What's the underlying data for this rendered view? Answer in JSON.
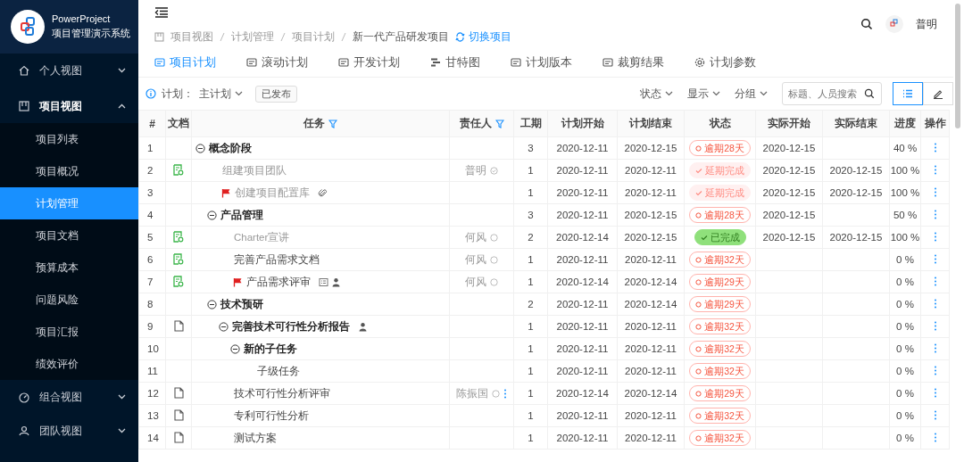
{
  "brand": {
    "name": "PowerProject",
    "subtitle": "项目管理演示系统"
  },
  "sidebar": {
    "groups": [
      {
        "label": "个人视图",
        "expanded": false,
        "selected": false
      },
      {
        "label": "项目视图",
        "expanded": true,
        "selected": true,
        "children": [
          {
            "label": "项目列表",
            "selected": false
          },
          {
            "label": "项目概况",
            "selected": false
          },
          {
            "label": "计划管理",
            "selected": true
          },
          {
            "label": "项目文档",
            "selected": false
          },
          {
            "label": "预算成本",
            "selected": false
          },
          {
            "label": "问题风险",
            "selected": false
          },
          {
            "label": "项目汇报",
            "selected": false
          },
          {
            "label": "绩效评价",
            "selected": false
          }
        ]
      },
      {
        "label": "组合视图",
        "expanded": false,
        "selected": false
      },
      {
        "label": "团队视图",
        "expanded": false,
        "selected": false
      }
    ]
  },
  "header": {
    "user": "普明"
  },
  "breadcrumb": {
    "items": [
      "项目视图",
      "计划管理",
      "项目计划",
      "新一代产品研发项目"
    ],
    "switch_link": "切换项目"
  },
  "tabs": [
    {
      "label": "项目计划",
      "selected": true
    },
    {
      "label": "滚动计划",
      "selected": false
    },
    {
      "label": "开发计划",
      "selected": false
    },
    {
      "label": "甘特图",
      "selected": false
    },
    {
      "label": "计划版本",
      "selected": false
    },
    {
      "label": "裁剪结果",
      "selected": false
    },
    {
      "label": "计划参数",
      "selected": false
    }
  ],
  "toolbar": {
    "plan_label": "计划：",
    "plan_value": "主计划",
    "badge": "已发布",
    "filters": [
      "状态",
      "显示",
      "分组"
    ],
    "search": {
      "placeholder": "标题、人员搜索"
    },
    "views": [
      {
        "kind": "list",
        "selected": true
      },
      {
        "kind": "edit",
        "selected": false
      }
    ]
  },
  "table": {
    "columns": [
      {
        "label": "#",
        "filter": false
      },
      {
        "label": "文档",
        "filter": false
      },
      {
        "label": "任务",
        "filter": true
      },
      {
        "label": "责任人",
        "filter": true
      },
      {
        "label": "工期",
        "filter": false
      },
      {
        "label": "计划开始",
        "filter": false
      },
      {
        "label": "计划结束",
        "filter": false
      },
      {
        "label": "状态",
        "filter": false
      },
      {
        "label": "实际开始",
        "filter": false
      },
      {
        "label": "实际结束",
        "filter": false
      },
      {
        "label": "进度",
        "filter": false
      },
      {
        "label": "操作",
        "filter": false
      }
    ],
    "rows": [
      {
        "num": "1",
        "task": "概念阶段",
        "bold": true,
        "done": false,
        "flagged": false,
        "duration": "3",
        "plan_start": "2020-12-11",
        "plan_end": "2020-12-15",
        "status": {
          "kind": "overdue",
          "label": "逾期28天"
        },
        "actual_start": "2020-12-15",
        "progress": "40 %",
        "expanded": true,
        "children": [
          {
            "num": "2",
            "doc": {
              "kind": "plan"
            },
            "task": "组建项目团队",
            "bold": false,
            "done": true,
            "flagged": false,
            "owner": {
              "name": "普明",
              "done": true,
              "more": false
            },
            "duration": "1",
            "plan_start": "2020-12-11",
            "plan_end": "2020-12-11",
            "status": {
              "kind": "late-done",
              "label": "延期完成"
            },
            "actual_start": "2020-12-15",
            "actual_end": "2020-12-15",
            "progress": "100 %"
          },
          {
            "num": "3",
            "task": "创建项目配置库",
            "bold": false,
            "done": true,
            "flagged": true,
            "markers": [
              {
                "kind": "attachment"
              }
            ],
            "duration": "1",
            "plan_start": "2020-12-11",
            "plan_end": "2020-12-11",
            "status": {
              "kind": "late-done",
              "label": "延期完成"
            },
            "actual_start": "2020-12-15",
            "actual_end": "2020-12-15",
            "progress": "100 %"
          },
          {
            "num": "4",
            "task": "产品管理",
            "bold": true,
            "done": false,
            "flagged": false,
            "duration": "3",
            "plan_start": "2020-12-11",
            "plan_end": "2020-12-15",
            "status": {
              "kind": "overdue",
              "label": "逾期28天"
            },
            "actual_start": "2020-12-15",
            "progress": "50 %",
            "expanded": true,
            "children": [
              {
                "num": "5",
                "doc": {
                  "kind": "plan"
                },
                "task": "Charter宣讲",
                "bold": false,
                "done": true,
                "flagged": false,
                "owner": {
                  "name": "何风",
                  "done": false,
                  "more": false
                },
                "duration": "2",
                "plan_start": "2020-12-14",
                "plan_end": "2020-12-15",
                "status": {
                  "kind": "done",
                  "label": "已完成"
                },
                "actual_start": "2020-12-15",
                "actual_end": "2020-12-15",
                "progress": "100 %"
              },
              {
                "num": "6",
                "doc": {
                  "kind": "plan"
                },
                "task": "完善产品需求文档",
                "bold": false,
                "done": false,
                "flagged": false,
                "owner": {
                  "name": "何风",
                  "done": false,
                  "more": false
                },
                "duration": "1",
                "plan_start": "2020-12-11",
                "plan_end": "2020-12-11",
                "status": {
                  "kind": "overdue",
                  "label": "逾期32天"
                },
                "progress": "0 %"
              },
              {
                "num": "7",
                "doc": {
                  "kind": "plan"
                },
                "task": "产品需求评审",
                "bold": false,
                "done": false,
                "flagged": true,
                "markers": [
                  {
                    "kind": "form"
                  },
                  {
                    "kind": "member"
                  }
                ],
                "owner": {
                  "name": "何风",
                  "done": false,
                  "more": false
                },
                "duration": "1",
                "plan_start": "2020-12-14",
                "plan_end": "2020-12-14",
                "status": {
                  "kind": "overdue",
                  "label": "逾期29天"
                },
                "progress": "0 %"
              }
            ]
          },
          {
            "num": "8",
            "task": "技术预研",
            "bold": true,
            "done": false,
            "flagged": false,
            "duration": "2",
            "plan_start": "2020-12-11",
            "plan_end": "2020-12-14",
            "status": {
              "kind": "overdue",
              "label": "逾期29天"
            },
            "progress": "0 %",
            "expanded": true,
            "children": [
              {
                "num": "9",
                "doc": {
                  "kind": "file"
                },
                "task": "完善技术可行性分析报告",
                "bold": true,
                "done": false,
                "flagged": false,
                "markers": [
                  {
                    "kind": "member"
                  }
                ],
                "duration": "1",
                "plan_start": "2020-12-11",
                "plan_end": "2020-12-11",
                "status": {
                  "kind": "overdue",
                  "label": "逾期32天"
                },
                "progress": "0 %",
                "expanded": true,
                "children": [
                  {
                    "num": "10",
                    "task": "新的子任务",
                    "bold": true,
                    "done": false,
                    "flagged": false,
                    "duration": "1",
                    "plan_start": "2020-12-11",
                    "plan_end": "2020-12-11",
                    "status": {
                      "kind": "overdue",
                      "label": "逾期32天"
                    },
                    "progress": "0 %",
                    "expanded": true,
                    "children": [
                      {
                        "num": "11",
                        "task": "子级任务",
                        "bold": false,
                        "done": false,
                        "flagged": false,
                        "duration": "1",
                        "plan_start": "2020-12-11",
                        "plan_end": "2020-12-11",
                        "status": {
                          "kind": "overdue",
                          "label": "逾期32天"
                        },
                        "progress": "0 %"
                      }
                    ]
                  }
                ]
              },
              {
                "num": "12",
                "doc": {
                  "kind": "file"
                },
                "task": "技术可行性分析评审",
                "bold": false,
                "done": false,
                "flagged": false,
                "owner": {
                  "name": "陈振国",
                  "done": false,
                  "more": true
                },
                "duration": "1",
                "plan_start": "2020-12-14",
                "plan_end": "2020-12-14",
                "status": {
                  "kind": "overdue",
                  "label": "逾期29天"
                },
                "progress": "0 %"
              },
              {
                "num": "13",
                "doc": {
                  "kind": "file"
                },
                "task": "专利可行性分析",
                "bold": false,
                "done": false,
                "flagged": false,
                "duration": "1",
                "plan_start": "2020-12-11",
                "plan_end": "2020-12-11",
                "status": {
                  "kind": "overdue",
                  "label": "逾期32天"
                },
                "progress": "0 %"
              },
              {
                "num": "14",
                "doc": {
                  "kind": "file"
                },
                "task": "测试方案",
                "bold": false,
                "done": false,
                "flagged": false,
                "duration": "1",
                "plan_start": "2020-12-11",
                "plan_end": "2020-12-11",
                "status": {
                  "kind": "overdue",
                  "label": "逾期32天"
                },
                "progress": "0 %"
              }
            ]
          }
        ]
      }
    ]
  }
}
